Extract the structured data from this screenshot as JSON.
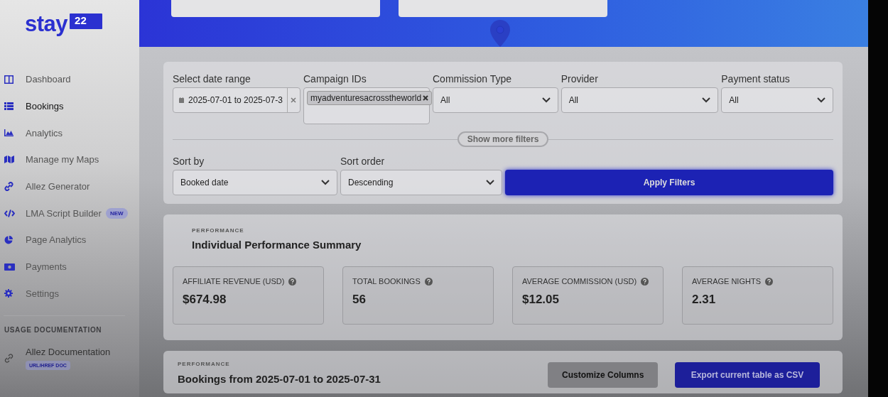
{
  "logo": {
    "text": "stay",
    "badge": "22"
  },
  "sidebar": {
    "items": [
      {
        "label": "Dashboard",
        "kind": "columns",
        "selected": false
      },
      {
        "label": "Bookings",
        "kind": "list",
        "selected": true
      },
      {
        "label": "Analytics",
        "kind": "area",
        "selected": false
      },
      {
        "label": "Manage my Maps",
        "kind": "map",
        "selected": false
      },
      {
        "label": "Allez Generator",
        "kind": "link",
        "selected": false
      },
      {
        "label": "LMA Script Builder",
        "kind": "code",
        "selected": false,
        "badge": "NEW"
      },
      {
        "label": "Page Analytics",
        "kind": "pie",
        "selected": false
      },
      {
        "label": "Payments",
        "kind": "money",
        "selected": false
      },
      {
        "label": "Settings",
        "kind": "gear",
        "selected": false
      }
    ],
    "section": {
      "title": "USAGE DOCUMENTATION",
      "items": [
        {
          "label": "Allez Documentation",
          "kind": "link-outline",
          "badge": "URL/HREF DOC"
        }
      ]
    }
  },
  "filters": {
    "fields": [
      {
        "kind": "date",
        "label": "Select date range",
        "value": "2025-07-01 to 2025-07-3"
      },
      {
        "kind": "tags",
        "label": "Campaign IDs",
        "tags": [
          "myadventuresacrosstheworld"
        ]
      },
      {
        "kind": "select",
        "label": "Commission Type",
        "value": "All"
      },
      {
        "kind": "select",
        "label": "Provider",
        "value": "All"
      },
      {
        "kind": "select",
        "label": "Payment status",
        "value": "All"
      }
    ],
    "more_button": "Show more filters",
    "sort_fields": [
      {
        "kind": "select",
        "label": "Sort by",
        "value": "Booked date"
      },
      {
        "kind": "select",
        "label": "Sort order",
        "value": "Descending"
      }
    ],
    "apply_button": "Apply Filters"
  },
  "performance": {
    "eyebrow": "PERFORMANCE",
    "title": "Individual Performance Summary",
    "stats": [
      {
        "label": "AFFILIATE REVENUE (USD)",
        "value": "$674.98"
      },
      {
        "label": "TOTAL BOOKINGS",
        "value": "56"
      },
      {
        "label": "AVERAGE COMMISSION (USD)",
        "value": "$12.05"
      },
      {
        "label": "AVERAGE NIGHTS",
        "value": "2.31"
      }
    ]
  },
  "bookings": {
    "eyebrow": "PERFORMANCE",
    "title": "Bookings from 2025-07-01 to 2025-07-31",
    "buttons": [
      {
        "kind": "secondary",
        "label": "Customize Columns"
      },
      {
        "kind": "primary",
        "label": "Export current table as CSV"
      }
    ]
  }
}
